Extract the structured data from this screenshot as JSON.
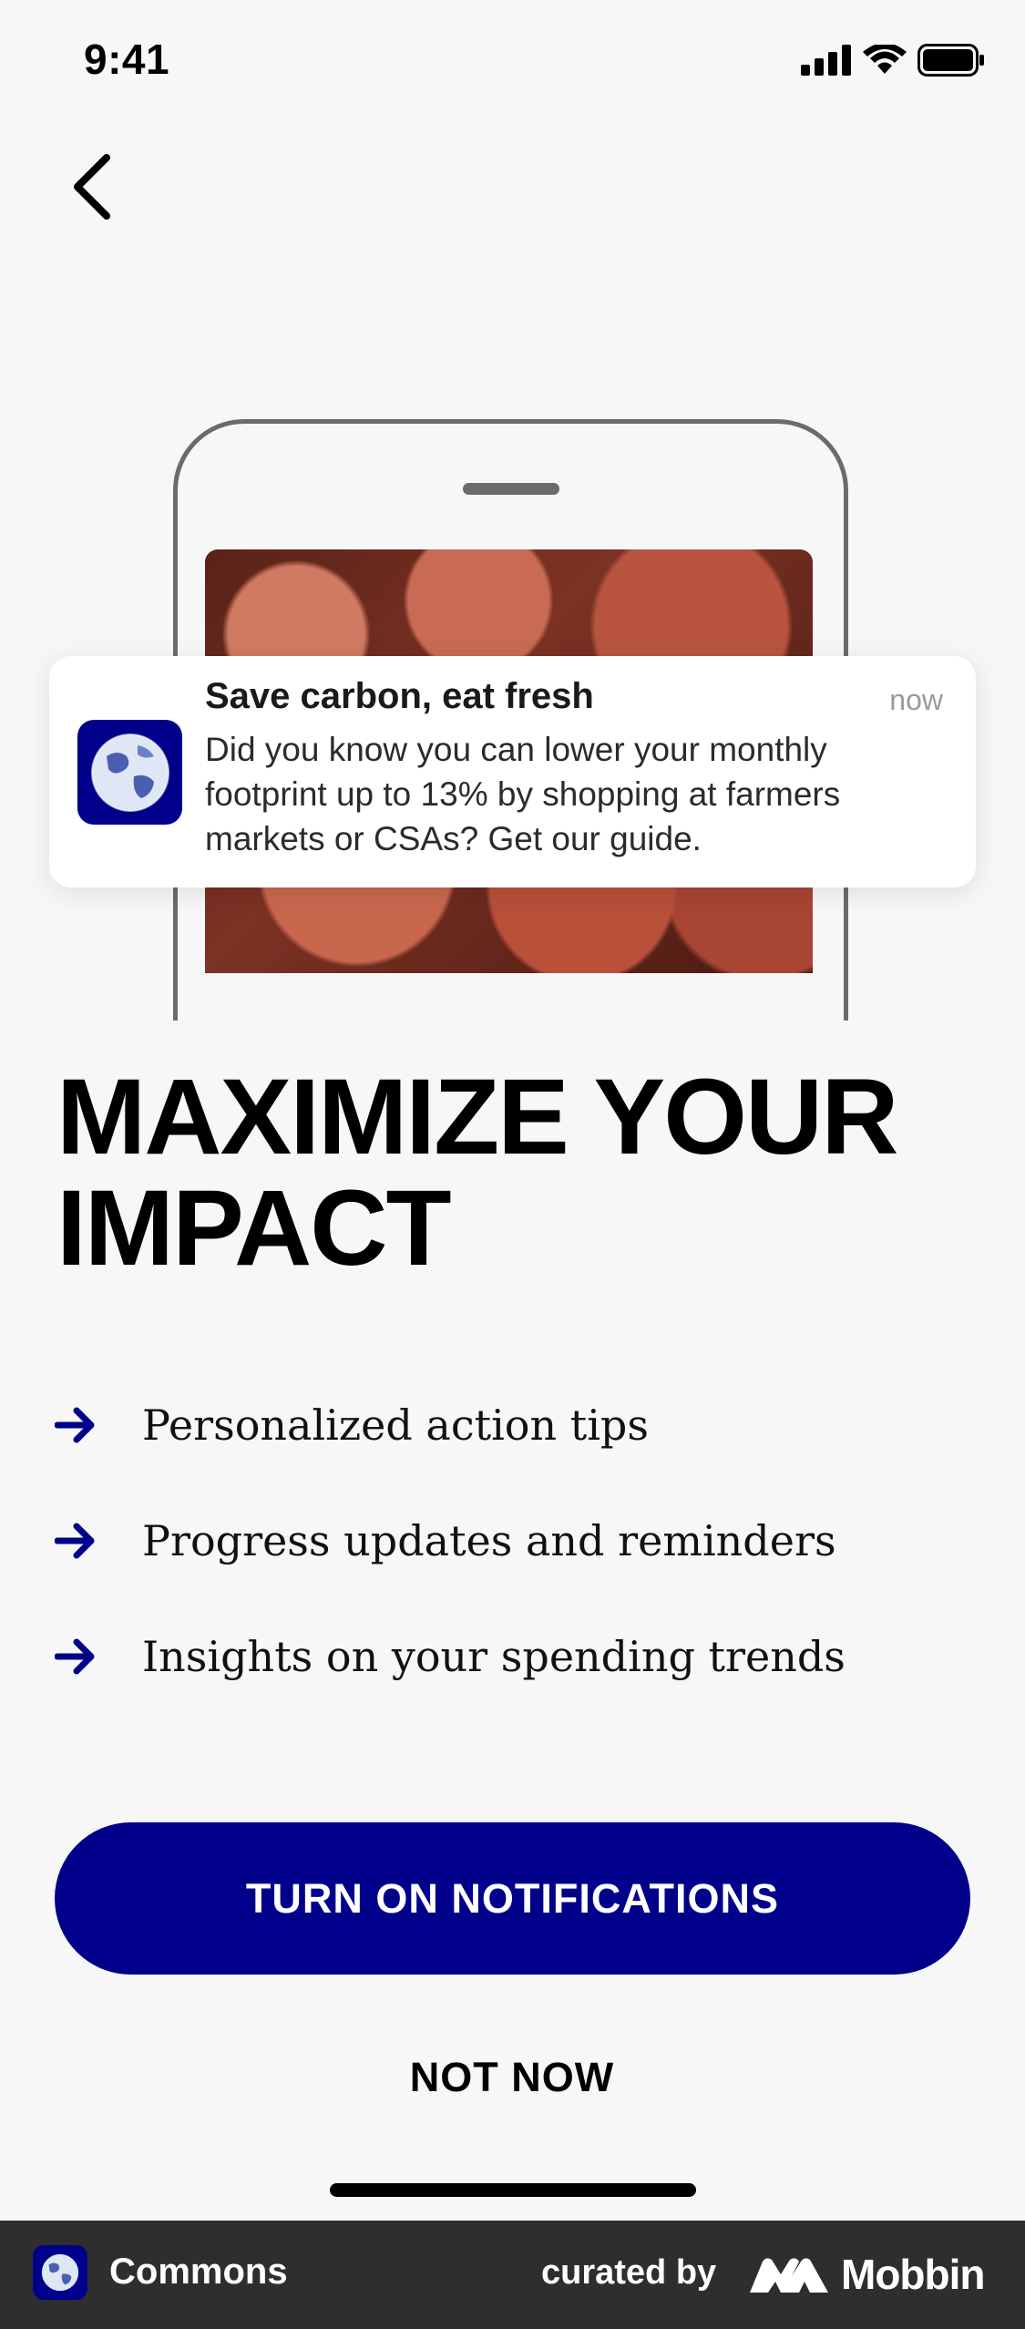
{
  "status_bar": {
    "time": "9:41"
  },
  "notification": {
    "title": "Save carbon, eat fresh",
    "time": "now",
    "body": "Did you know you can lower your monthly footprint up to 13% by shopping at farmers markets or CSAs? Get our guide."
  },
  "headline": "MAXIMIZE YOUR IMPACT",
  "benefits": [
    {
      "label": "Personalized action tips"
    },
    {
      "label": "Progress updates and reminders"
    },
    {
      "label": "Insights on your spending trends"
    }
  ],
  "actions": {
    "primary_label": "TURN ON NOTIFICATIONS",
    "secondary_label": "NOT NOW"
  },
  "footer": {
    "app_name": "Commons",
    "curated_by": "curated by",
    "brand": "Mobbin"
  },
  "colors": {
    "accent": "#00008B",
    "background": "#F7F7F7",
    "footer_background": "#2E2E2E"
  }
}
